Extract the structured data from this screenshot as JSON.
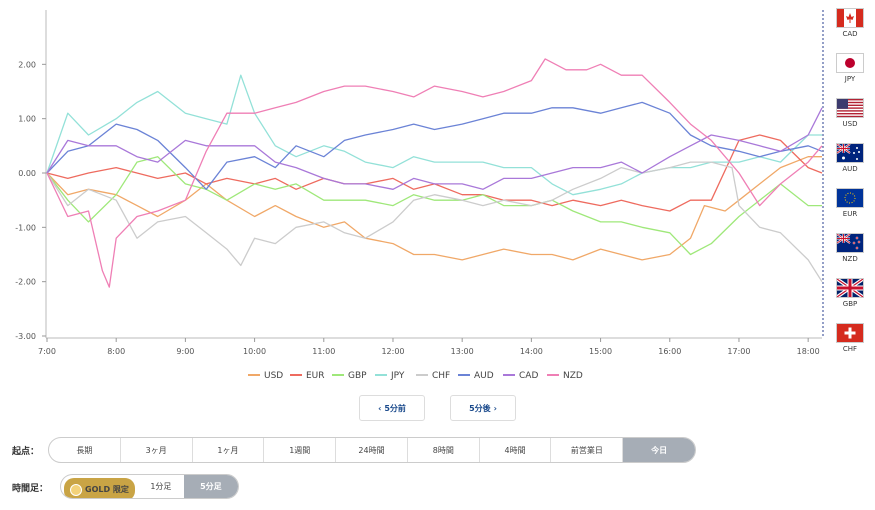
{
  "chart_data": {
    "type": "line",
    "x_ticks": [
      "7:00",
      "8:00",
      "9:00",
      "10:00",
      "11:00",
      "12:00",
      "13:00",
      "14:00",
      "15:00",
      "16:00",
      "17:00",
      "18:00"
    ],
    "y_ticks": [
      "2.00",
      "1.00",
      "0.00",
      "-1.00",
      "-2.00",
      "-3.00"
    ],
    "ylim": [
      -3,
      3
    ],
    "xlim_hours": [
      7,
      18.2
    ],
    "grid": false,
    "legend_position": "bottom",
    "series": [
      {
        "name": "USD",
        "color": "#f0a868",
        "points": [
          [
            7,
            0.0
          ],
          [
            7.3,
            -0.4
          ],
          [
            7.6,
            -0.3
          ],
          [
            8,
            -0.4
          ],
          [
            8.3,
            -0.6
          ],
          [
            8.6,
            -0.8
          ],
          [
            9,
            -0.5
          ],
          [
            9.3,
            -0.2
          ],
          [
            9.6,
            -0.5
          ],
          [
            10,
            -0.8
          ],
          [
            10.3,
            -0.6
          ],
          [
            10.6,
            -0.8
          ],
          [
            11,
            -1.0
          ],
          [
            11.3,
            -0.9
          ],
          [
            11.6,
            -1.2
          ],
          [
            12,
            -1.3
          ],
          [
            12.3,
            -1.5
          ],
          [
            12.6,
            -1.5
          ],
          [
            13,
            -1.6
          ],
          [
            13.3,
            -1.5
          ],
          [
            13.6,
            -1.4
          ],
          [
            14,
            -1.5
          ],
          [
            14.3,
            -1.5
          ],
          [
            14.6,
            -1.6
          ],
          [
            15,
            -1.4
          ],
          [
            15.3,
            -1.5
          ],
          [
            15.6,
            -1.6
          ],
          [
            16,
            -1.5
          ],
          [
            16.3,
            -1.2
          ],
          [
            16.5,
            -0.6
          ],
          [
            16.8,
            -0.7
          ],
          [
            17,
            -0.5
          ],
          [
            17.3,
            -0.2
          ],
          [
            17.6,
            0.1
          ],
          [
            18,
            0.3
          ],
          [
            18.2,
            0.3
          ]
        ]
      },
      {
        "name": "EUR",
        "color": "#ee6b5f",
        "points": [
          [
            7,
            0.0
          ],
          [
            7.3,
            -0.1
          ],
          [
            7.6,
            0.0
          ],
          [
            8,
            0.1
          ],
          [
            8.3,
            0.0
          ],
          [
            8.6,
            -0.1
          ],
          [
            9,
            0.0
          ],
          [
            9.3,
            -0.2
          ],
          [
            9.6,
            -0.1
          ],
          [
            10,
            -0.2
          ],
          [
            10.3,
            -0.1
          ],
          [
            10.6,
            -0.3
          ],
          [
            11,
            -0.1
          ],
          [
            11.3,
            -0.2
          ],
          [
            11.6,
            -0.2
          ],
          [
            12,
            -0.1
          ],
          [
            12.3,
            -0.3
          ],
          [
            12.6,
            -0.2
          ],
          [
            13,
            -0.4
          ],
          [
            13.3,
            -0.4
          ],
          [
            13.6,
            -0.5
          ],
          [
            14,
            -0.5
          ],
          [
            14.3,
            -0.6
          ],
          [
            14.6,
            -0.5
          ],
          [
            15,
            -0.6
          ],
          [
            15.3,
            -0.5
          ],
          [
            15.6,
            -0.6
          ],
          [
            16,
            -0.7
          ],
          [
            16.3,
            -0.5
          ],
          [
            16.6,
            -0.5
          ],
          [
            17,
            0.6
          ],
          [
            17.3,
            0.7
          ],
          [
            17.6,
            0.6
          ],
          [
            18,
            0.1
          ],
          [
            18.2,
            0.0
          ]
        ]
      },
      {
        "name": "GBP",
        "color": "#9fe87a",
        "points": [
          [
            7,
            0.0
          ],
          [
            7.3,
            -0.5
          ],
          [
            7.6,
            -0.9
          ],
          [
            8,
            -0.4
          ],
          [
            8.3,
            0.2
          ],
          [
            8.6,
            0.3
          ],
          [
            9,
            -0.2
          ],
          [
            9.3,
            -0.3
          ],
          [
            9.6,
            -0.5
          ],
          [
            10,
            -0.2
          ],
          [
            10.3,
            -0.3
          ],
          [
            10.6,
            -0.2
          ],
          [
            11,
            -0.5
          ],
          [
            11.3,
            -0.5
          ],
          [
            11.6,
            -0.5
          ],
          [
            12,
            -0.6
          ],
          [
            12.3,
            -0.4
          ],
          [
            12.6,
            -0.5
          ],
          [
            13,
            -0.5
          ],
          [
            13.3,
            -0.4
          ],
          [
            13.6,
            -0.6
          ],
          [
            14,
            -0.6
          ],
          [
            14.3,
            -0.5
          ],
          [
            14.6,
            -0.7
          ],
          [
            15,
            -0.9
          ],
          [
            15.3,
            -0.9
          ],
          [
            15.6,
            -1.0
          ],
          [
            16,
            -1.1
          ],
          [
            16.3,
            -1.5
          ],
          [
            16.6,
            -1.3
          ],
          [
            17,
            -0.8
          ],
          [
            17.3,
            -0.5
          ],
          [
            17.6,
            -0.2
          ],
          [
            18,
            -0.6
          ],
          [
            18.2,
            -0.6
          ]
        ]
      },
      {
        "name": "JPY",
        "color": "#93e1d8",
        "points": [
          [
            7,
            0.0
          ],
          [
            7.3,
            1.1
          ],
          [
            7.6,
            0.7
          ],
          [
            8,
            1.0
          ],
          [
            8.3,
            1.3
          ],
          [
            8.6,
            1.5
          ],
          [
            9,
            1.1
          ],
          [
            9.3,
            1.0
          ],
          [
            9.6,
            0.9
          ],
          [
            9.8,
            1.8
          ],
          [
            10,
            1.1
          ],
          [
            10.3,
            0.5
          ],
          [
            10.6,
            0.3
          ],
          [
            11,
            0.5
          ],
          [
            11.3,
            0.4
          ],
          [
            11.6,
            0.2
          ],
          [
            12,
            0.1
          ],
          [
            12.3,
            0.3
          ],
          [
            12.6,
            0.2
          ],
          [
            13,
            0.2
          ],
          [
            13.3,
            0.2
          ],
          [
            13.6,
            0.1
          ],
          [
            14,
            0.1
          ],
          [
            14.3,
            -0.2
          ],
          [
            14.6,
            -0.4
          ],
          [
            15,
            -0.3
          ],
          [
            15.3,
            -0.2
          ],
          [
            15.6,
            0.0
          ],
          [
            16,
            0.1
          ],
          [
            16.3,
            0.1
          ],
          [
            16.6,
            0.2
          ],
          [
            17,
            0.2
          ],
          [
            17.3,
            0.3
          ],
          [
            17.6,
            0.2
          ],
          [
            18,
            0.7
          ],
          [
            18.2,
            0.7
          ]
        ]
      },
      {
        "name": "CHF",
        "color": "#cccccc",
        "points": [
          [
            7,
            0.0
          ],
          [
            7.3,
            -0.6
          ],
          [
            7.6,
            -0.3
          ],
          [
            8,
            -0.5
          ],
          [
            8.3,
            -1.2
          ],
          [
            8.6,
            -0.9
          ],
          [
            9,
            -0.8
          ],
          [
            9.3,
            -1.1
          ],
          [
            9.6,
            -1.4
          ],
          [
            9.8,
            -1.7
          ],
          [
            10,
            -1.2
          ],
          [
            10.3,
            -1.3
          ],
          [
            10.6,
            -1.0
          ],
          [
            11,
            -0.9
          ],
          [
            11.3,
            -1.1
          ],
          [
            11.6,
            -1.2
          ],
          [
            12,
            -0.9
          ],
          [
            12.3,
            -0.5
          ],
          [
            12.6,
            -0.4
          ],
          [
            13,
            -0.5
          ],
          [
            13.3,
            -0.6
          ],
          [
            13.6,
            -0.5
          ],
          [
            14,
            -0.6
          ],
          [
            14.3,
            -0.5
          ],
          [
            14.6,
            -0.3
          ],
          [
            15,
            -0.1
          ],
          [
            15.3,
            0.1
          ],
          [
            15.6,
            0.0
          ],
          [
            16,
            0.1
          ],
          [
            16.3,
            0.2
          ],
          [
            16.6,
            0.2
          ],
          [
            16.9,
            0.1
          ],
          [
            17,
            -0.6
          ],
          [
            17.3,
            -1.0
          ],
          [
            17.6,
            -1.1
          ],
          [
            18,
            -1.6
          ],
          [
            18.2,
            -2.0
          ]
        ]
      },
      {
        "name": "AUD",
        "color": "#6b83d6",
        "points": [
          [
            7,
            0.0
          ],
          [
            7.3,
            0.4
          ],
          [
            7.6,
            0.5
          ],
          [
            8,
            0.9
          ],
          [
            8.3,
            0.8
          ],
          [
            8.6,
            0.6
          ],
          [
            9,
            0.1
          ],
          [
            9.3,
            -0.3
          ],
          [
            9.6,
            0.2
          ],
          [
            10,
            0.3
          ],
          [
            10.3,
            0.1
          ],
          [
            10.6,
            0.5
          ],
          [
            11,
            0.3
          ],
          [
            11.3,
            0.6
          ],
          [
            11.6,
            0.7
          ],
          [
            12,
            0.8
          ],
          [
            12.3,
            0.9
          ],
          [
            12.6,
            0.8
          ],
          [
            13,
            0.9
          ],
          [
            13.3,
            1.0
          ],
          [
            13.6,
            1.1
          ],
          [
            14,
            1.1
          ],
          [
            14.3,
            1.2
          ],
          [
            14.6,
            1.2
          ],
          [
            15,
            1.1
          ],
          [
            15.3,
            1.2
          ],
          [
            15.6,
            1.3
          ],
          [
            16,
            1.1
          ],
          [
            16.3,
            0.7
          ],
          [
            16.6,
            0.5
          ],
          [
            17,
            0.4
          ],
          [
            17.3,
            0.3
          ],
          [
            17.6,
            0.4
          ],
          [
            18,
            0.5
          ],
          [
            18.2,
            0.4
          ]
        ]
      },
      {
        "name": "CAD",
        "color": "#a978d9",
        "points": [
          [
            7,
            0.0
          ],
          [
            7.3,
            0.6
          ],
          [
            7.6,
            0.5
          ],
          [
            8,
            0.5
          ],
          [
            8.3,
            0.3
          ],
          [
            8.6,
            0.2
          ],
          [
            9,
            0.6
          ],
          [
            9.3,
            0.5
          ],
          [
            9.6,
            0.5
          ],
          [
            10,
            0.5
          ],
          [
            10.3,
            0.2
          ],
          [
            10.6,
            0.1
          ],
          [
            11,
            -0.1
          ],
          [
            11.3,
            -0.2
          ],
          [
            11.6,
            -0.2
          ],
          [
            12,
            -0.3
          ],
          [
            12.3,
            -0.1
          ],
          [
            12.6,
            -0.2
          ],
          [
            13,
            -0.2
          ],
          [
            13.3,
            -0.3
          ],
          [
            13.6,
            -0.1
          ],
          [
            14,
            -0.1
          ],
          [
            14.3,
            0.0
          ],
          [
            14.6,
            0.1
          ],
          [
            15,
            0.1
          ],
          [
            15.3,
            0.2
          ],
          [
            15.6,
            0.0
          ],
          [
            16,
            0.3
          ],
          [
            16.3,
            0.5
          ],
          [
            16.6,
            0.7
          ],
          [
            17,
            0.6
          ],
          [
            17.3,
            0.5
          ],
          [
            17.6,
            0.4
          ],
          [
            18,
            0.7
          ],
          [
            18.2,
            1.2
          ]
        ]
      },
      {
        "name": "NZD",
        "color": "#ef7fb5",
        "points": [
          [
            7,
            0.0
          ],
          [
            7.3,
            -0.8
          ],
          [
            7.6,
            -0.7
          ],
          [
            7.8,
            -1.8
          ],
          [
            7.9,
            -2.1
          ],
          [
            8,
            -1.2
          ],
          [
            8.3,
            -0.8
          ],
          [
            8.6,
            -0.7
          ],
          [
            9,
            -0.5
          ],
          [
            9.3,
            0.4
          ],
          [
            9.6,
            1.1
          ],
          [
            10,
            1.1
          ],
          [
            10.3,
            1.2
          ],
          [
            10.6,
            1.3
          ],
          [
            11,
            1.5
          ],
          [
            11.3,
            1.6
          ],
          [
            11.6,
            1.6
          ],
          [
            12,
            1.5
          ],
          [
            12.3,
            1.4
          ],
          [
            12.6,
            1.6
          ],
          [
            13,
            1.5
          ],
          [
            13.3,
            1.4
          ],
          [
            13.6,
            1.5
          ],
          [
            14,
            1.7
          ],
          [
            14.2,
            2.1
          ],
          [
            14.5,
            1.9
          ],
          [
            14.8,
            1.9
          ],
          [
            15,
            2.0
          ],
          [
            15.3,
            1.8
          ],
          [
            15.6,
            1.8
          ],
          [
            16,
            1.3
          ],
          [
            16.3,
            0.9
          ],
          [
            16.6,
            0.6
          ],
          [
            17,
            0.0
          ],
          [
            17.3,
            -0.6
          ],
          [
            17.6,
            -0.2
          ],
          [
            18,
            0.2
          ],
          [
            18.2,
            0.5
          ]
        ]
      }
    ]
  },
  "flags": [
    {
      "code": "CAD",
      "icon": "canada-flag"
    },
    {
      "code": "JPY",
      "icon": "japan-flag"
    },
    {
      "code": "USD",
      "icon": "usa-flag"
    },
    {
      "code": "AUD",
      "icon": "australia-flag"
    },
    {
      "code": "EUR",
      "icon": "eu-flag"
    },
    {
      "code": "NZD",
      "icon": "newzealand-flag"
    },
    {
      "code": "GBP",
      "icon": "uk-flag"
    },
    {
      "code": "CHF",
      "icon": "swiss-flag"
    }
  ],
  "nav": {
    "prev_label": "5分前",
    "next_label": "5分後"
  },
  "start": {
    "label": "起点：",
    "options": [
      "長期",
      "3ヶ月",
      "1ヶ月",
      "1週間",
      "24時間",
      "8時間",
      "4時間",
      "前営業日",
      "今日"
    ],
    "selected": "今日"
  },
  "timeframe": {
    "label": "時間足：",
    "gold_label": "GOLD 限定",
    "options": [
      "1分足",
      "5分足"
    ],
    "selected": "5分足"
  }
}
